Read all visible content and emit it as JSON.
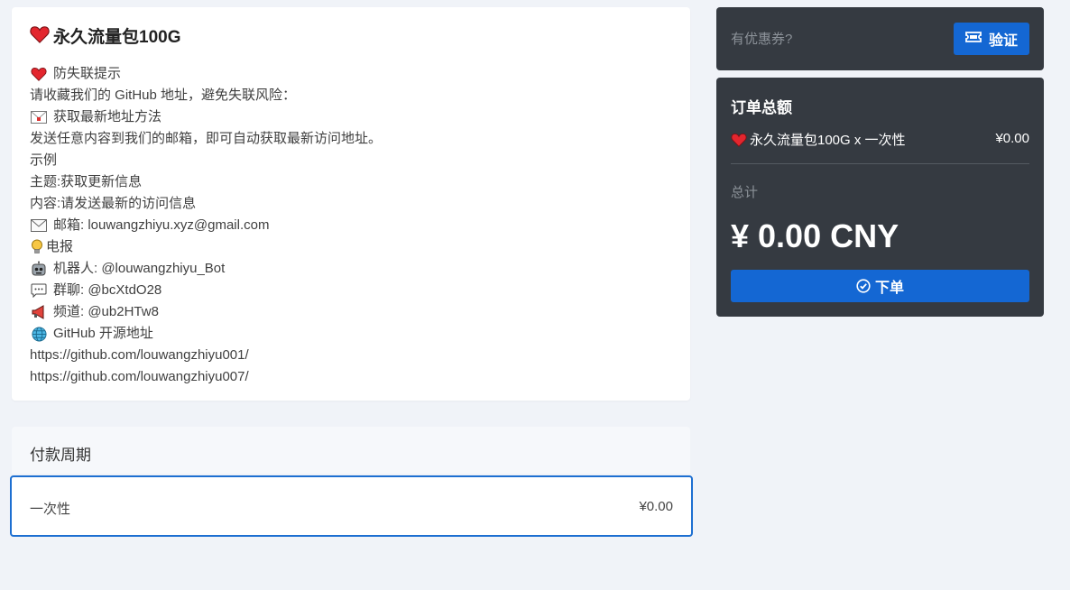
{
  "product": {
    "title": "永久流量包100G",
    "icon": "heart-icon"
  },
  "description": {
    "lines": [
      {
        "icon": "heart-icon",
        "text": "防失联提示"
      },
      {
        "icon": "",
        "text": "请收藏我们的 GitHub 地址，避免失联风险："
      },
      {
        "icon": "envelope-icon",
        "text": "获取最新地址方法"
      },
      {
        "icon": "",
        "text": "发送任意内容到我们的邮箱，即可自动获取最新访问地址。"
      },
      {
        "icon": "",
        "text": "示例"
      },
      {
        "icon": "",
        "text": "主题:获取更新信息"
      },
      {
        "icon": "",
        "text": "内容:请发送最新的访问信息"
      },
      {
        "icon": "mail-icon",
        "text": "邮箱: louwangzhiyu.xyz@gmail.com"
      },
      {
        "icon": "lightbulb-icon",
        "text": "电报"
      },
      {
        "icon": "robot-icon",
        "text": "机器人: @louwangzhiyu_Bot"
      },
      {
        "icon": "speech-bubble-icon",
        "text": "群聊: @bcXtdO28"
      },
      {
        "icon": "megaphone-icon",
        "text": "频道: @ub2HTw8"
      },
      {
        "icon": "globe-icon",
        "text": "GitHub 开源地址"
      },
      {
        "icon": "",
        "text": "https://github.com/louwangzhiyu001/"
      },
      {
        "icon": "",
        "text": "https://github.com/louwangzhiyu007/"
      }
    ]
  },
  "period": {
    "title": "付款周期",
    "option_label": "一次性",
    "option_price": "¥0.00"
  },
  "coupon": {
    "placeholder": "有优惠券?",
    "verify_label": "验证"
  },
  "summary": {
    "title": "订单总额",
    "item_label": "永久流量包100G x 一次性",
    "item_price": "¥0.00",
    "total_label": "总计",
    "total_amount": "¥ 0.00 CNY",
    "order_label": "下单"
  },
  "colors": {
    "accent": "#1467d3",
    "dark_panel": "#353a41",
    "page_bg": "#f0f3f8",
    "heart": "#e3262e"
  }
}
